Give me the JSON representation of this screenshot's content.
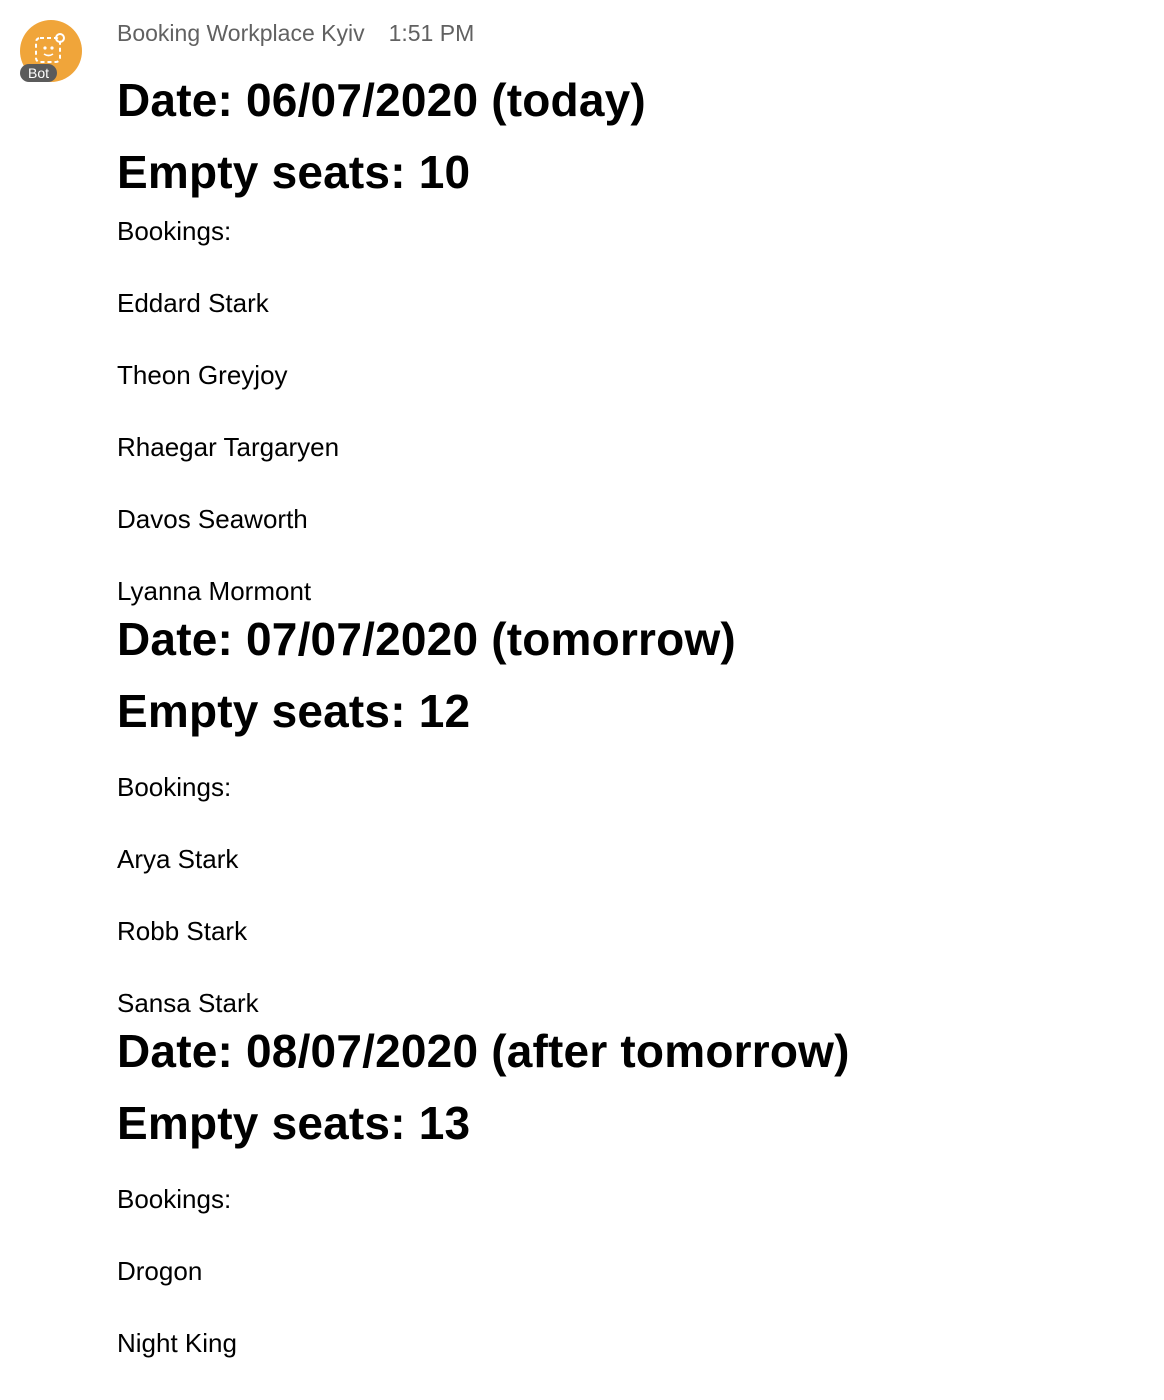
{
  "message": {
    "sender": "Booking Workplace Kyiv",
    "time": "1:51 PM",
    "badge": "Bot",
    "avatar_color": "#f0a53a",
    "avatar_icon": "bot-icon"
  },
  "days": [
    {
      "date": "Date: 06/07/2020 (today)",
      "empty_seats": "Empty seats: 10",
      "bookings_label": "Bookings:",
      "bookings": [
        "Eddard Stark",
        "Theon Greyjoy",
        "Rhaegar Targaryen",
        "Davos Seaworth",
        "Lyanna Mormont"
      ]
    },
    {
      "date": "Date: 07/07/2020 (tomorrow)",
      "empty_seats": "Empty seats: 12",
      "bookings_label": "Bookings:",
      "bookings": [
        "Arya Stark",
        "Robb Stark",
        "Sansa Stark"
      ]
    },
    {
      "date": "Date: 08/07/2020 (after tomorrow)",
      "empty_seats": "Empty seats: 13",
      "bookings_label": "Bookings:",
      "bookings": [
        "Drogon",
        "Night King"
      ]
    }
  ]
}
